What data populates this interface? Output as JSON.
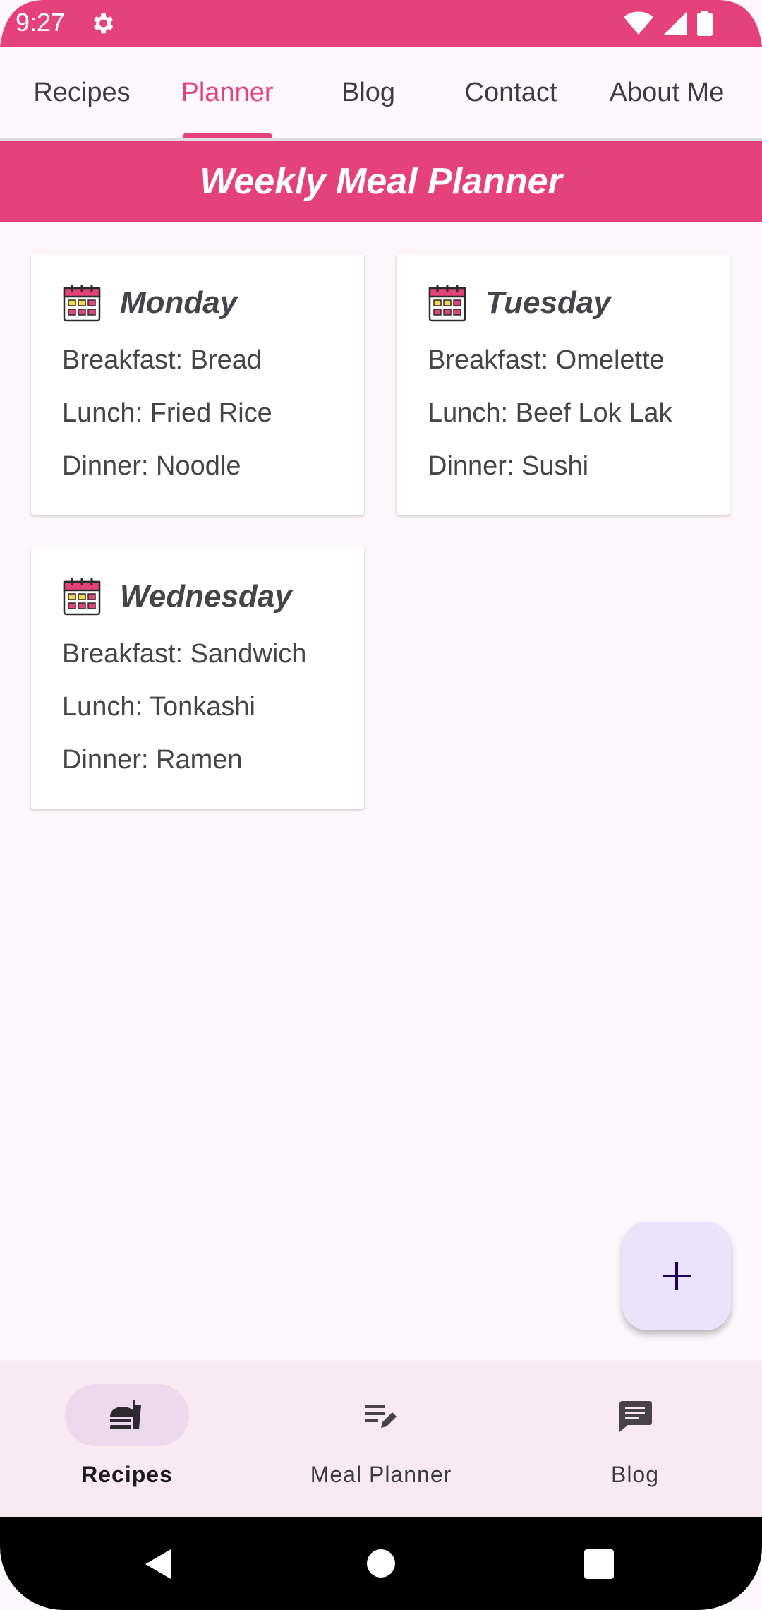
{
  "status_bar": {
    "time": "9:27",
    "color": "#e5417a"
  },
  "top_tabs": [
    {
      "label": "Recipes",
      "active": false
    },
    {
      "label": "Planner",
      "active": true
    },
    {
      "label": "Blog",
      "active": false
    },
    {
      "label": "Contact",
      "active": false
    },
    {
      "label": "About Me",
      "active": false
    }
  ],
  "banner": {
    "title": "Weekly Meal Planner"
  },
  "days": [
    {
      "icon": "calendar-icon",
      "name": "Monday",
      "breakfast": "Breakfast: Bread",
      "lunch": "Lunch: Fried Rice",
      "dinner": "Dinner: Noodle"
    },
    {
      "icon": "calendar-icon",
      "name": "Tuesday",
      "breakfast": "Breakfast: Omelette",
      "lunch": "Lunch: Beef Lok Lak",
      "dinner": "Dinner: Sushi"
    },
    {
      "icon": "calendar-icon",
      "name": "Wednesday",
      "breakfast": "Breakfast: Sandwich",
      "lunch": "Lunch: Tonkashi",
      "dinner": "Dinner: Ramen"
    }
  ],
  "fab": {
    "icon": "plus-icon"
  },
  "bottom_nav": [
    {
      "label": "Recipes",
      "icon": "fastfood-icon",
      "active": true
    },
    {
      "label": "Meal Planner",
      "icon": "edit-list-icon",
      "active": false
    },
    {
      "label": "Blog",
      "icon": "chat-bubble-icon",
      "active": false
    }
  ],
  "colors": {
    "accent": "#e5417a",
    "background": "#fef7fb",
    "fab_bg": "#ece2fb",
    "nav_bg": "#f9e9f1"
  }
}
